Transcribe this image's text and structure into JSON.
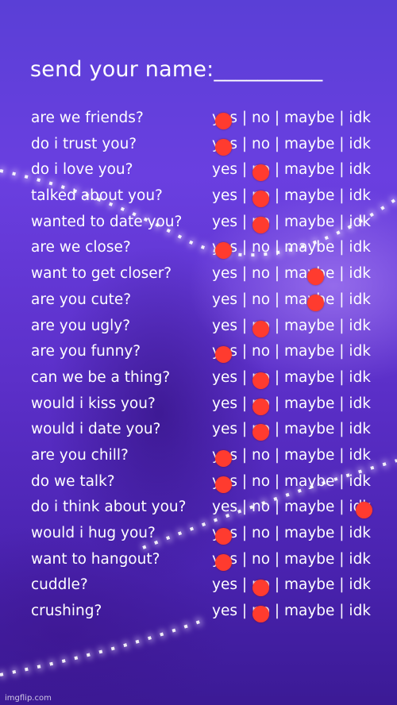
{
  "title": "send your name:__________",
  "options_text": "yes | no | maybe | idk",
  "mark_color": "#ff3b2f",
  "questions": [
    {
      "q": "are we friends?",
      "answer": "yes"
    },
    {
      "q": "do i trust you?",
      "answer": "yes"
    },
    {
      "q": "do i love you?",
      "answer": "no"
    },
    {
      "q": "talked about you?",
      "answer": "no"
    },
    {
      "q": "wanted to date you?",
      "answer": "no"
    },
    {
      "q": "are we close?",
      "answer": "yes"
    },
    {
      "q": "want to get closer?",
      "answer": "maybe"
    },
    {
      "q": "are you cute?",
      "answer": "maybe"
    },
    {
      "q": "are you ugly?",
      "answer": "no"
    },
    {
      "q": "are you funny?",
      "answer": "yes"
    },
    {
      "q": "can we be a thing?",
      "answer": "no"
    },
    {
      "q": "would i kiss you?",
      "answer": "no"
    },
    {
      "q": "would i date you?",
      "answer": "no"
    },
    {
      "q": "are you chill?",
      "answer": "yes"
    },
    {
      "q": "do we talk?",
      "answer": "yes"
    },
    {
      "q": "do i think about you?",
      "answer": "idk"
    },
    {
      "q": "would i hug you?",
      "answer": "yes"
    },
    {
      "q": "want to hangout?",
      "answer": "yes"
    },
    {
      "q": "cuddle?",
      "answer": "no"
    },
    {
      "q": "crushing?",
      "answer": "no"
    }
  ],
  "watermark": "imgflip.com"
}
